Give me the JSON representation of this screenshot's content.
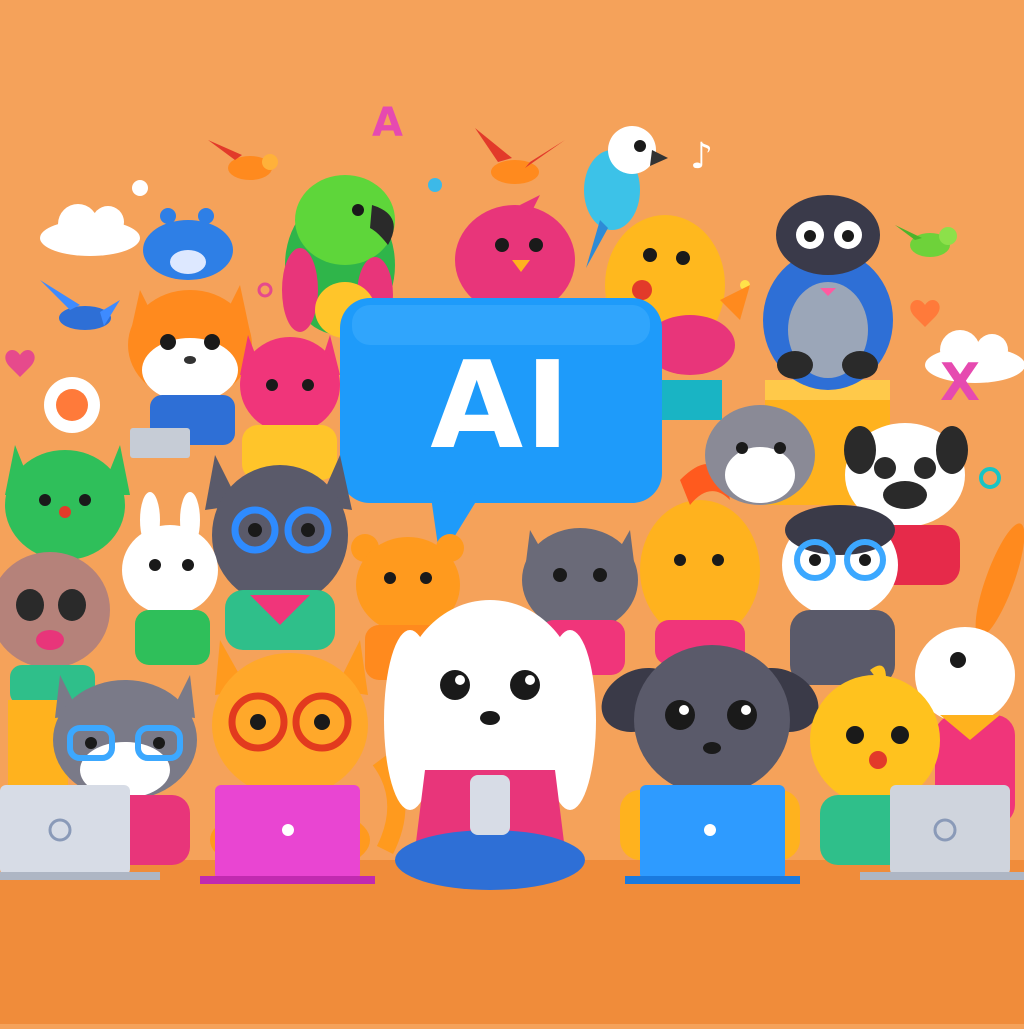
{
  "scene": {
    "description_label": "",
    "speech_bubble": {
      "text": "AI"
    },
    "decor_glyphs": {
      "letter_a": "A",
      "letter_x": "X",
      "music_note": "♪"
    },
    "colors": {
      "background": "#F5A25A",
      "bubble": "#1E9BFA",
      "floor": "#F08C3A"
    },
    "characters": [
      {
        "name": "green-parrot"
      },
      {
        "name": "pink-bird"
      },
      {
        "name": "yellow-bird"
      },
      {
        "name": "blue-owl-penguin"
      },
      {
        "name": "orange-cat"
      },
      {
        "name": "pink-cat"
      },
      {
        "name": "grey-cat-glasses"
      },
      {
        "name": "white-dog"
      },
      {
        "name": "grey-dog"
      },
      {
        "name": "orange-cat-glasses"
      },
      {
        "name": "yellow-chick"
      },
      {
        "name": "white-rabbit"
      }
    ],
    "laptops": [
      {
        "color": "#D7DCE6"
      },
      {
        "color": "#E945D2"
      },
      {
        "color": "#2E9BFF"
      },
      {
        "color": "#CFD4DD"
      }
    ]
  }
}
